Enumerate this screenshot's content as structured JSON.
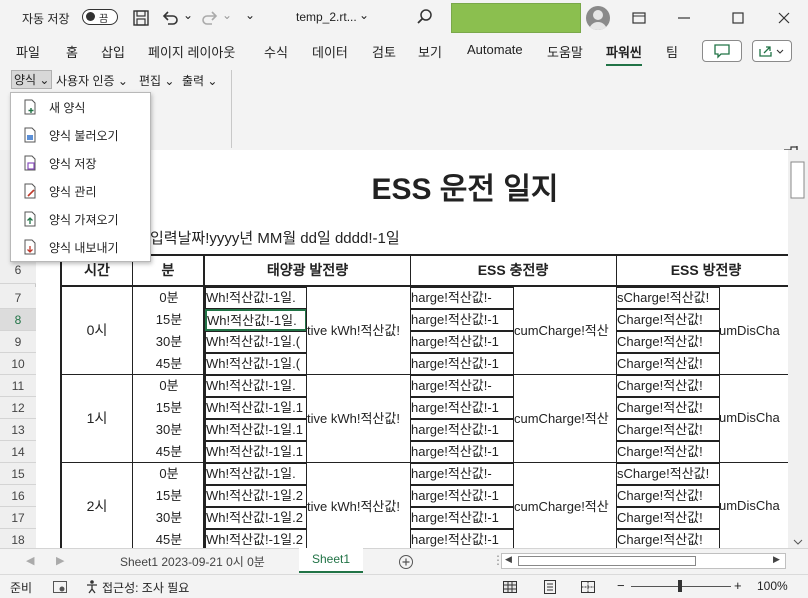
{
  "titlebar": {
    "autosave_label": "자동 저장",
    "autosave_state": "끔",
    "filename": "temp_2.rt...",
    "dropdown_glyph": "⌄"
  },
  "ribbon_tabs": [
    "파일",
    "홈",
    "삽입",
    "페이지 레이아웃",
    "수식",
    "데이터",
    "검토",
    "보기",
    "Automate",
    "도움말",
    "파워씬",
    "팀"
  ],
  "active_tab": "파워씬",
  "ribbon_menus": [
    "양식 ⌄",
    "사용자 인증 ⌄",
    "편집 ⌄",
    "출력 ⌄"
  ],
  "dropdown_items": [
    {
      "label": "새 양식",
      "icon": "new-form-icon"
    },
    {
      "label": "양식 불러오기",
      "icon": "load-form-icon"
    },
    {
      "label": "양식 저장",
      "icon": "save-form-icon"
    },
    {
      "label": "양식 관리",
      "icon": "manage-form-icon"
    },
    {
      "label": "양식 가져오기",
      "icon": "import-form-icon"
    },
    {
      "label": "양식 내보내기",
      "icon": "export-form-icon"
    }
  ],
  "sheet": {
    "title": "ESS 운전 일지",
    "date_line": "입력날짜!yyyy년 MM월 dd일 dddd!-1일",
    "headers": [
      "시간",
      "분",
      "태양광 발전량",
      "ESS 충전량",
      "ESS 방전량"
    ],
    "row_numbers": [
      "6",
      "7",
      "8",
      "9",
      "10",
      "11",
      "12",
      "13",
      "14",
      "15",
      "16",
      "17",
      "18"
    ],
    "hours": [
      "0시",
      "1시",
      "2시"
    ],
    "minutes": [
      "0분",
      "15분",
      "30분",
      "45분"
    ],
    "pv_cells": [
      [
        "Wh!적산값!-1일.",
        "Wh!적산값!-1일.",
        "Wh!적산값!-1일.(",
        "Wh!적산값!-1일.("
      ],
      [
        "Wh!적산값!-1일.",
        "Wh!적산값!-1일.1",
        "Wh!적산값!-1일.1",
        "Wh!적산값!-1일.1"
      ],
      [
        "Wh!적산값!-1일.",
        "Wh!적산값!-1일.2",
        "Wh!적산값!-1일.2",
        "Wh!적산값!-1일.2"
      ]
    ],
    "pv_merged": [
      "tive kWh!적산값!",
      "tive kWh!적산값!",
      "tive kWh!적산값!"
    ],
    "charge_cells": [
      "harge!적산값!-",
      "harge!적산값!-1",
      "harge!적산값!-1",
      "harge!적산값!-1"
    ],
    "charge_merged": "cumCharge!적산",
    "discharge_cells": [
      "sCharge!적산값!",
      "Charge!적산값!",
      "Charge!적산값!",
      "Charge!적산값!"
    ],
    "discharge_merged": "umDisCha"
  },
  "sheet_tabs": [
    "Sheet1  2023-09-21 0시 0분",
    "Sheet1"
  ],
  "active_sheet": "Sheet1",
  "status": {
    "ready": "준비",
    "accessibility": "접근성: 조사 필요",
    "zoom": "100%"
  },
  "colors": {
    "accent": "#217346",
    "highlight": "#8bbf4f"
  }
}
